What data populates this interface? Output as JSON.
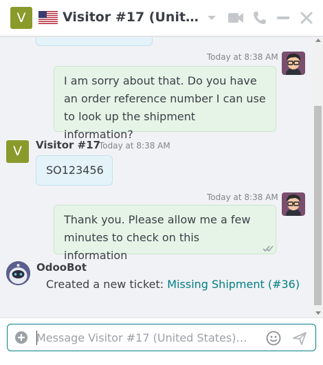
{
  "header": {
    "avatar_letter": "V",
    "title": "Visitor #17 (United States)",
    "icons": [
      "flag-us-icon",
      "chevron-down-icon",
      "video-camera-icon",
      "phone-icon",
      "minimize-icon",
      "close-icon"
    ]
  },
  "messages": [
    {
      "id": "m1",
      "side": "out",
      "time": "Today at 8:38 AM",
      "text": "I am sorry about that. Do you have an order reference number I can use to look up the shipment information?"
    },
    {
      "id": "m2",
      "side": "in",
      "author": "Visitor #17",
      "avatar_letter": "V",
      "time": "Today at 8:38 AM",
      "text": "SO123456"
    },
    {
      "id": "m3",
      "side": "out",
      "time": "Today at 8:38 AM",
      "text": "Thank you. Please allow me a few minutes to check on this information",
      "status": "read"
    },
    {
      "id": "m4",
      "side": "bot",
      "author": "OdooBot",
      "text_prefix": "Created a new ticket: ",
      "link_text": "Missing Shipment (#36)"
    }
  ],
  "composer": {
    "placeholder": "Message Visitor #17 (United States)…"
  },
  "colors": {
    "accent": "#017e84",
    "outgoing_bubble": "#e6f4e8",
    "incoming_bubble": "#e4f3f9",
    "visitor_avatar": "#8a9a2b"
  }
}
